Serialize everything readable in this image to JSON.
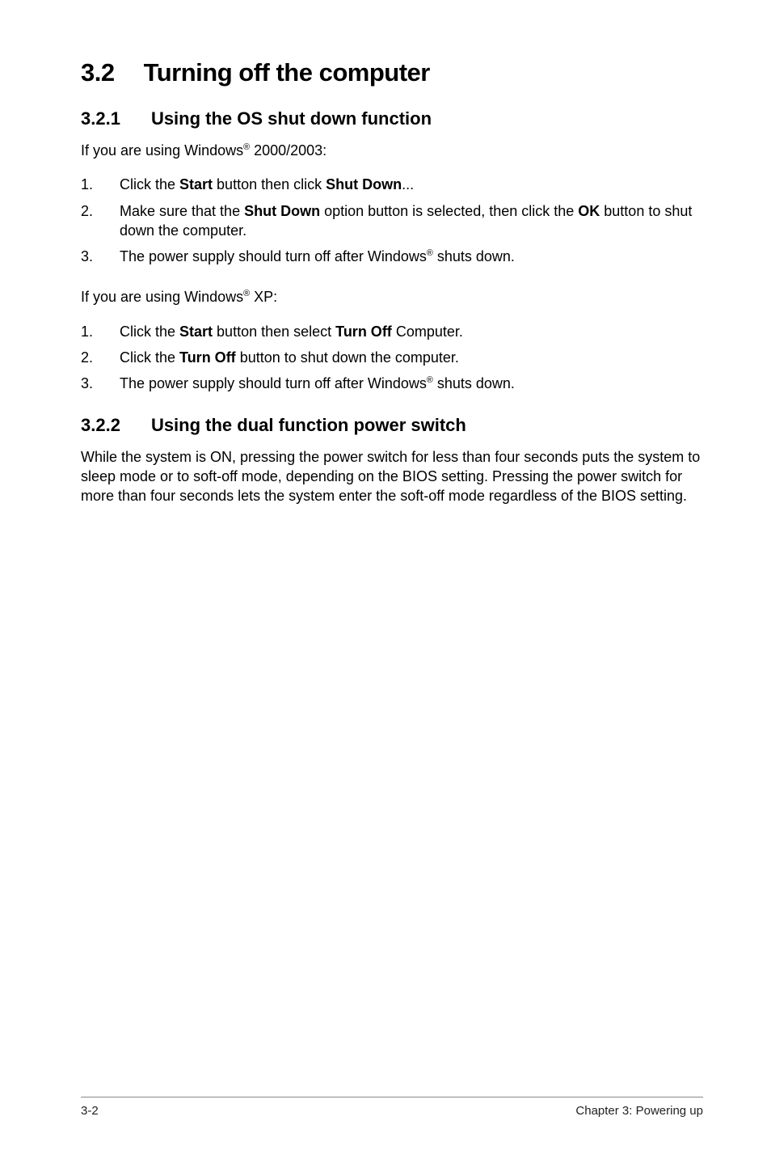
{
  "h1": {
    "num": "3.2",
    "title": "Turning off the computer"
  },
  "s1": {
    "num": "3.2.1",
    "title": "Using the OS shut down function",
    "intro_pre": "If you are using Windows",
    "intro_post": " 2000/2003:",
    "items": [
      {
        "idx": "1.",
        "pre": "Click the ",
        "b1": "Start",
        "mid": " button then click ",
        "b2": "Shut Down",
        "post": "..."
      },
      {
        "idx": "2.",
        "pre": "Make sure that the ",
        "b1": "Shut Down",
        "mid": " option button is selected, then click the ",
        "b2": "OK",
        "post": " button to shut down the computer."
      },
      {
        "idx": "3.",
        "pre": "The power supply should turn off after Windows",
        "sup": "®",
        "post": " shuts down."
      }
    ],
    "intro2_pre": "If you are using Windows",
    "intro2_post": " XP:",
    "items2": [
      {
        "idx": "1.",
        "pre": "Click the ",
        "b1": "Start",
        "mid": " button then select ",
        "b2": "Turn Off",
        "post": " Computer."
      },
      {
        "idx": "2.",
        "pre": "Click the ",
        "b1": "Turn Off",
        "post": " button to shut down the computer."
      },
      {
        "idx": "3.",
        "pre": "The power supply should turn off after Windows",
        "sup": "®",
        "post": " shuts down."
      }
    ]
  },
  "s2": {
    "num": "3.2.2",
    "title": "Using the dual function power switch",
    "body": "While the system is ON, pressing the power switch for less than four seconds puts the system to sleep mode or to soft-off mode, depending on the BIOS setting. Pressing the power switch for more than four seconds lets the system enter the soft-off mode regardless of the BIOS setting."
  },
  "footer": {
    "left": "3-2",
    "right": "Chapter 3: Powering up"
  },
  "sup": "®"
}
